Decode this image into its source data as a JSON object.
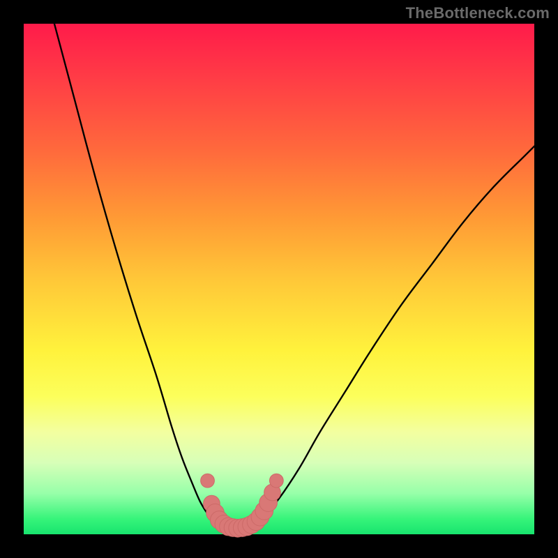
{
  "watermark": "TheBottleneck.com",
  "colors": {
    "curve_stroke": "#000000",
    "marker_fill": "#d97876",
    "marker_stroke": "#cc6a68"
  },
  "chart_data": {
    "type": "line",
    "title": "",
    "xlabel": "",
    "ylabel": "",
    "xlim": [
      0,
      100
    ],
    "ylim": [
      0,
      100
    ],
    "series": [
      {
        "name": "left-branch",
        "x": [
          6,
          10,
          14,
          18,
          22,
          26,
          29,
          31,
          33,
          34.5,
          36,
          37,
          38
        ],
        "y": [
          100,
          85,
          70,
          56,
          43,
          31,
          21,
          15,
          10,
          6.5,
          4,
          2.5,
          1.8
        ]
      },
      {
        "name": "right-branch",
        "x": [
          45,
          47,
          50,
          54,
          58,
          63,
          68,
          74,
          80,
          86,
          92,
          98,
          100
        ],
        "y": [
          1.8,
          3.5,
          7,
          13,
          20,
          28,
          36,
          45,
          53,
          61,
          68,
          74,
          76
        ]
      },
      {
        "name": "valley-floor",
        "x": [
          38,
          39.5,
          41,
          42.5,
          44,
          45
        ],
        "y": [
          1.8,
          1.3,
          1.1,
          1.1,
          1.3,
          1.8
        ]
      }
    ],
    "markers": [
      {
        "x": 36.0,
        "y": 10.5,
        "r": 1.0
      },
      {
        "x": 36.8,
        "y": 6.0,
        "r": 1.2
      },
      {
        "x": 37.5,
        "y": 4.2,
        "r": 1.3
      },
      {
        "x": 38.3,
        "y": 2.8,
        "r": 1.3
      },
      {
        "x": 39.2,
        "y": 2.0,
        "r": 1.3
      },
      {
        "x": 40.1,
        "y": 1.5,
        "r": 1.3
      },
      {
        "x": 41.0,
        "y": 1.3,
        "r": 1.3
      },
      {
        "x": 41.9,
        "y": 1.2,
        "r": 1.3
      },
      {
        "x": 42.8,
        "y": 1.3,
        "r": 1.3
      },
      {
        "x": 43.7,
        "y": 1.5,
        "r": 1.3
      },
      {
        "x": 44.6,
        "y": 1.9,
        "r": 1.3
      },
      {
        "x": 45.5,
        "y": 2.5,
        "r": 1.3
      },
      {
        "x": 46.3,
        "y": 3.4,
        "r": 1.3
      },
      {
        "x": 47.1,
        "y": 4.6,
        "r": 1.3
      },
      {
        "x": 47.9,
        "y": 6.2,
        "r": 1.3
      },
      {
        "x": 48.7,
        "y": 8.2,
        "r": 1.2
      },
      {
        "x": 49.5,
        "y": 10.5,
        "r": 1.0
      }
    ]
  }
}
